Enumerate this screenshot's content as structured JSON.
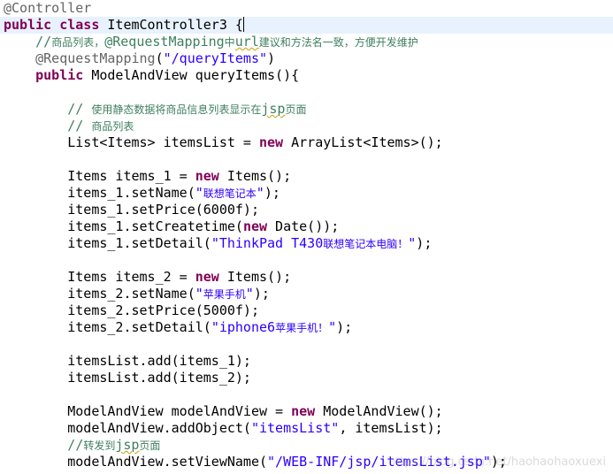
{
  "colors": {
    "keyword": "#7f0055",
    "annotation": "#646464",
    "string": "#2a00ff",
    "comment": "#3f7f5f",
    "current_line": "#e8f2fe"
  },
  "code_lines": [
    [
      {
        "t": "ann",
        "v": "@Controller"
      }
    ],
    [
      {
        "t": "kw",
        "v": "public"
      },
      {
        "t": "plain",
        "v": " "
      },
      {
        "t": "kw",
        "v": "class"
      },
      {
        "t": "plain",
        "v": " ItemController3 {"
      },
      {
        "t": "caret",
        "v": ""
      }
    ],
    [
      {
        "t": "plain",
        "v": "    "
      },
      {
        "t": "com",
        "v": "//商品列表，@RequestMapping中"
      },
      {
        "t": "comsq",
        "v": "url"
      },
      {
        "t": "com",
        "v": "建议和方法名一致，方便开发维护"
      }
    ],
    [
      {
        "t": "plain",
        "v": "    "
      },
      {
        "t": "ann",
        "v": "@RequestMapping"
      },
      {
        "t": "plain",
        "v": "("
      },
      {
        "t": "str",
        "v": "\"/queryItems\""
      },
      {
        "t": "plain",
        "v": ")"
      }
    ],
    [
      {
        "t": "plain",
        "v": "    "
      },
      {
        "t": "kw",
        "v": "public"
      },
      {
        "t": "plain",
        "v": " ModelAndView queryItems(){"
      }
    ],
    [],
    [
      {
        "t": "plain",
        "v": "        "
      },
      {
        "t": "com",
        "v": "// 使用静态数据将商品信息列表显示在"
      },
      {
        "t": "comsq",
        "v": "jsp"
      },
      {
        "t": "com",
        "v": "页面"
      }
    ],
    [
      {
        "t": "plain",
        "v": "        "
      },
      {
        "t": "com",
        "v": "// 商品列表"
      }
    ],
    [
      {
        "t": "plain",
        "v": "        List<Items> itemsList = "
      },
      {
        "t": "kw",
        "v": "new"
      },
      {
        "t": "plain",
        "v": " ArrayList<Items>();"
      }
    ],
    [],
    [
      {
        "t": "plain",
        "v": "        Items items_1 = "
      },
      {
        "t": "kw",
        "v": "new"
      },
      {
        "t": "plain",
        "v": " Items();"
      }
    ],
    [
      {
        "t": "plain",
        "v": "        items_1.setName("
      },
      {
        "t": "str",
        "v": "\"联想笔记本\""
      },
      {
        "t": "plain",
        "v": ");"
      }
    ],
    [
      {
        "t": "plain",
        "v": "        items_1.setPrice(6000f);"
      }
    ],
    [
      {
        "t": "plain",
        "v": "        items_1.setCreatetime("
      },
      {
        "t": "kw",
        "v": "new"
      },
      {
        "t": "plain",
        "v": " Date());"
      }
    ],
    [
      {
        "t": "plain",
        "v": "        items_1.setDetail("
      },
      {
        "t": "str",
        "v": "\"ThinkPad T430联想笔记本电脑！\""
      },
      {
        "t": "plain",
        "v": ");"
      }
    ],
    [],
    [
      {
        "t": "plain",
        "v": "        Items items_2 = "
      },
      {
        "t": "kw",
        "v": "new"
      },
      {
        "t": "plain",
        "v": " Items();"
      }
    ],
    [
      {
        "t": "plain",
        "v": "        items_2.setName("
      },
      {
        "t": "str",
        "v": "\"苹果手机\""
      },
      {
        "t": "plain",
        "v": ");"
      }
    ],
    [
      {
        "t": "plain",
        "v": "        items_2.setPrice(5000f);"
      }
    ],
    [
      {
        "t": "plain",
        "v": "        items_2.setDetail("
      },
      {
        "t": "str",
        "v": "\"iphone6苹果手机！\""
      },
      {
        "t": "plain",
        "v": ");"
      }
    ],
    [],
    [
      {
        "t": "plain",
        "v": "        itemsList.add(items_1);"
      }
    ],
    [
      {
        "t": "plain",
        "v": "        itemsList.add(items_2);"
      }
    ],
    [],
    [
      {
        "t": "plain",
        "v": "        ModelAndView modelAndView = "
      },
      {
        "t": "kw",
        "v": "new"
      },
      {
        "t": "plain",
        "v": " ModelAndView();"
      }
    ],
    [
      {
        "t": "plain",
        "v": "        modelAndView.addObject("
      },
      {
        "t": "str",
        "v": "\"itemsList\""
      },
      {
        "t": "plain",
        "v": ", itemsList);"
      }
    ],
    [
      {
        "t": "plain",
        "v": "        "
      },
      {
        "t": "com",
        "v": "//转发到"
      },
      {
        "t": "comsq",
        "v": "jsp"
      },
      {
        "t": "com",
        "v": "页面"
      }
    ],
    [
      {
        "t": "plain",
        "v": "        modelAndView.setViewName("
      },
      {
        "t": "str",
        "v": "\"/WEB-INF/jsp/itemsList.jsp\""
      },
      {
        "t": "plain",
        "v": ");"
      }
    ]
  ],
  "current_line_index": 1,
  "watermark": "https://blog.csdn.net/haohaohaoxuexi"
}
